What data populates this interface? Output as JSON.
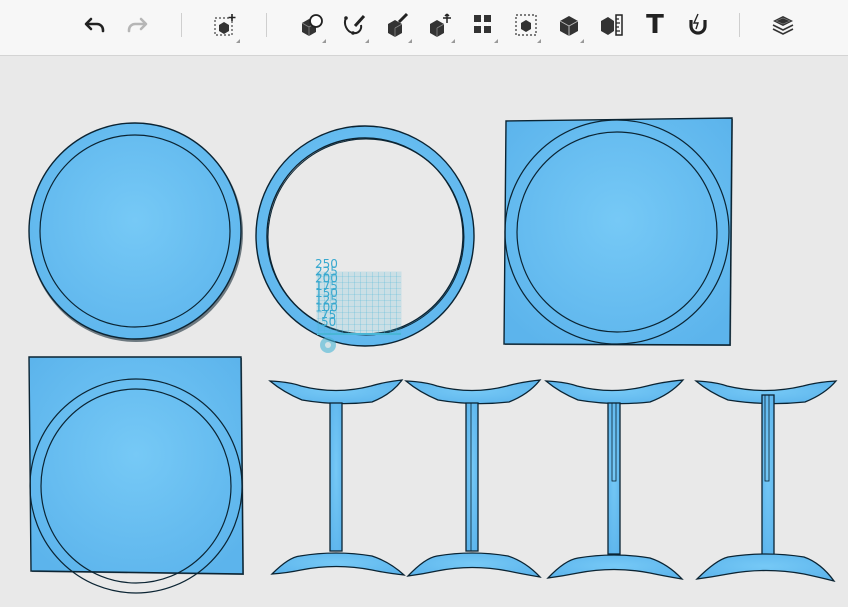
{
  "toolbar": {
    "tools": [
      {
        "name": "undo",
        "icon": "undo-icon"
      },
      {
        "name": "redo",
        "icon": "redo-icon",
        "disabled": true
      },
      {
        "name": "add-object",
        "icon": "add-box-icon"
      },
      {
        "name": "primitives",
        "icon": "primitives-icon"
      },
      {
        "name": "sketch",
        "icon": "sketch-icon"
      },
      {
        "name": "construct",
        "icon": "construct-icon"
      },
      {
        "name": "modify",
        "icon": "modify-icon"
      },
      {
        "name": "pattern",
        "icon": "pattern-icon"
      },
      {
        "name": "grouping",
        "icon": "grouping-icon"
      },
      {
        "name": "combine",
        "icon": "combine-icon"
      },
      {
        "name": "measure",
        "icon": "measure-icon"
      },
      {
        "name": "text",
        "icon": "text-icon",
        "label": "T"
      },
      {
        "name": "snap",
        "icon": "magnet-icon"
      },
      {
        "name": "materials",
        "icon": "layers-icon"
      }
    ]
  },
  "ruler": {
    "ticks": [
      "250",
      "225",
      "200",
      "175",
      "150",
      "125",
      "100",
      "75",
      "50"
    ]
  },
  "colors": {
    "part_fill": "#6ec3f4",
    "part_stroke": "#0b2433",
    "canvas": "#e9e9e9",
    "ruler": "#49b6d6"
  }
}
